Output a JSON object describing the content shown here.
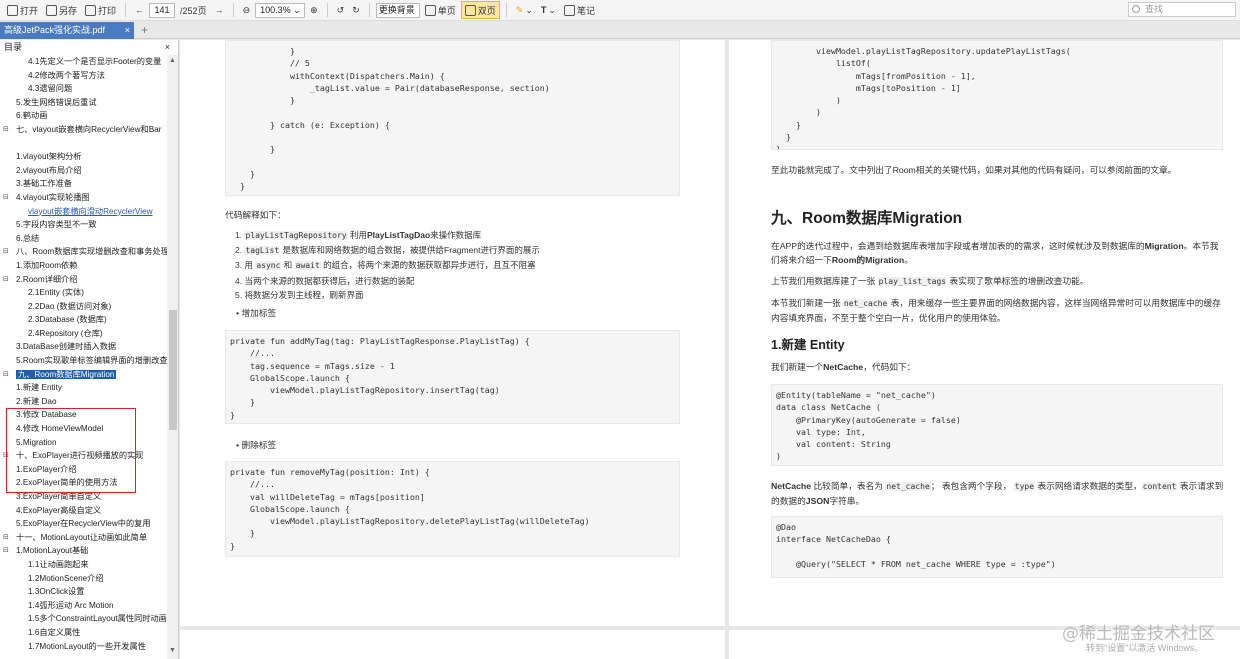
{
  "toolbar": {
    "open": "打开",
    "save_as": "另存",
    "print": "打印",
    "page_current": "141",
    "page_total": "/252页",
    "zoom": "100.3%",
    "background": "更换背景",
    "single_page": "单页",
    "double_page": "双页",
    "text": "T",
    "notes": "笔记",
    "search_placeholder": "查找"
  },
  "tab": {
    "title": "高级JetPack强化实战.pdf",
    "plus": "+"
  },
  "sidebar": {
    "title": "目录",
    "items": [
      {
        "label": "4.1先定义一个是否显示Footer的变量",
        "indent": 28,
        "toggle": ""
      },
      {
        "label": "4.2修改两个著写方法",
        "indent": 28,
        "toggle": ""
      },
      {
        "label": "4.3遗留问题",
        "indent": 28,
        "toggle": ""
      },
      {
        "label": "5.发生网络错误后重试",
        "indent": 16,
        "toggle": ""
      },
      {
        "label": "6.鹤动画",
        "indent": 16,
        "toggle": ""
      },
      {
        "label": "七、vlayout嵌套横向RecyclerView和Bar",
        "indent": 16,
        "toggle": "⊟"
      },
      {
        "label": "",
        "indent": 16,
        "toggle": ""
      },
      {
        "label": "1.vlayout架构分析",
        "indent": 16,
        "toggle": ""
      },
      {
        "label": "2.vlayout布局介绍",
        "indent": 16,
        "toggle": ""
      },
      {
        "label": "3.基础工作准备",
        "indent": 16,
        "toggle": ""
      },
      {
        "label": "4.vlayout实现轮播图",
        "indent": 16,
        "toggle": "⊟"
      },
      {
        "label": "vlayout嵌套横向滑动RecyclerView",
        "indent": 28,
        "toggle": "",
        "link": true
      },
      {
        "label": "5.字段内容类型不一致",
        "indent": 16,
        "toggle": ""
      },
      {
        "label": "6.总结",
        "indent": 16,
        "toggle": ""
      },
      {
        "label": "八、Room数据库实现增删改查和事务处理",
        "indent": 16,
        "toggle": "⊟"
      },
      {
        "label": "1.添加Room依赖",
        "indent": 16,
        "toggle": ""
      },
      {
        "label": "2.Room详细介绍",
        "indent": 16,
        "toggle": "⊟"
      },
      {
        "label": "2.1Entity (实体)",
        "indent": 28,
        "toggle": ""
      },
      {
        "label": "2.2Dao (数据访问对象)",
        "indent": 28,
        "toggle": ""
      },
      {
        "label": "2.3Database (数据库)",
        "indent": 28,
        "toggle": ""
      },
      {
        "label": "2.4Repository (仓库)",
        "indent": 28,
        "toggle": ""
      },
      {
        "label": "3.DataBase创建时插入数据",
        "indent": 16,
        "toggle": ""
      },
      {
        "label": "5.Room实现歌单标签编辑界面的增删改查",
        "indent": 16,
        "toggle": ""
      },
      {
        "label": "九、Room数据库Migration",
        "indent": 16,
        "toggle": "⊟",
        "selected": true
      },
      {
        "label": "1.新建 Entity",
        "indent": 16,
        "toggle": ""
      },
      {
        "label": "2.新建 Dao",
        "indent": 16,
        "toggle": ""
      },
      {
        "label": "3.修改 Database",
        "indent": 16,
        "toggle": ""
      },
      {
        "label": "4.修改 HomeViewModel",
        "indent": 16,
        "toggle": ""
      },
      {
        "label": "5.Migration",
        "indent": 16,
        "toggle": ""
      },
      {
        "label": "十、ExoPlayer进行视频播放的实现",
        "indent": 16,
        "toggle": "⊟"
      },
      {
        "label": "1.ExoPlayer介绍",
        "indent": 16,
        "toggle": ""
      },
      {
        "label": "2.ExoPlayer简单的使用方法",
        "indent": 16,
        "toggle": ""
      },
      {
        "label": "3.ExoPlayer简单自定义",
        "indent": 16,
        "toggle": ""
      },
      {
        "label": "4.ExoPlayer高级自定义",
        "indent": 16,
        "toggle": ""
      },
      {
        "label": "5.ExoPlayer在RecyclerView中的复用",
        "indent": 16,
        "toggle": ""
      },
      {
        "label": "十一、MotionLayout让动画如此简单",
        "indent": 16,
        "toggle": "⊟"
      },
      {
        "label": "1.MotionLayout基础",
        "indent": 16,
        "toggle": "⊟"
      },
      {
        "label": "1.1让动画跑起来",
        "indent": 28,
        "toggle": ""
      },
      {
        "label": "1.2MotionScene介绍",
        "indent": 28,
        "toggle": ""
      },
      {
        "label": "1.3OnClick设置",
        "indent": 28,
        "toggle": ""
      },
      {
        "label": "1.4弧形运动 Arc Motion",
        "indent": 28,
        "toggle": ""
      },
      {
        "label": "1.5多个ConstraintLayout属性同时动画",
        "indent": 28,
        "toggle": ""
      },
      {
        "label": "1.6自定义属性",
        "indent": 28,
        "toggle": ""
      },
      {
        "label": "1.7MotionLayout的一些开发属性",
        "indent": 28,
        "toggle": ""
      }
    ]
  },
  "left_page": {
    "code_top": "            }\n            // 5\n            withContext(Dispatchers.Main) {\n                _tagList.value = Pair(databaseResponse, section)\n            }\n\n        } catch (e: Exception) {\n\n        }\n\n    }\n  }\n}",
    "explain_title": "代码解释如下：",
    "list": [
      {
        "num": "1.",
        "code": "playListTagRepository",
        "mid": " 利用",
        "bold": "PlayListTagDao",
        "rest": "来操作数据库"
      },
      {
        "num": "2.",
        "code": "tagList",
        "mid": " 是数据库和网络数据的组合数据，被提供给Fragment进行界面的展示",
        "bold": "",
        "rest": ""
      },
      {
        "num": "3.",
        "pre": "用 ",
        "code": "async",
        "mid": " 和 ",
        "code2": "await",
        "rest": " 的组合，将两个来源的数据获取都异步进行，且互不阻塞"
      },
      {
        "num": "4.",
        "rest": "当两个来源的数据都获得后，进行数据的装配"
      },
      {
        "num": "5.",
        "rest": "将数据分发到主线程，刷新界面"
      }
    ],
    "bullet1": "增加标签",
    "code_add": "private fun addMyTag(tag: PlayListTagResponse.PlayListTag) {\n    //...\n    tag.sequence = mTags.size - 1\n    GlobalScope.launch {\n        viewModel.playListTagRepository.insertTag(tag)\n    }\n}",
    "bullet2": "删除标签",
    "code_remove": "private fun removeMyTag(position: Int) {\n    //...\n    val willDeleteTag = mTags[position]\n    GlobalScope.launch {\n        viewModel.playListTagRepository.deletePlayListTag(willDeleteTag)\n    }\n}"
  },
  "right_page": {
    "code_top": "        viewModel.playListTagRepository.updatePlayListTags(\n            listOf(\n                mTags[fromPosition - 1],\n                mTags[toPosition - 1]\n            )\n        )\n    }\n  }\n}",
    "done_text": "至此功能就完成了。文中列出了Room相关的关键代码，如果对其他的代码有疑问，可以参阅前面的文章。",
    "h2": "九、Room数据库Migration",
    "p1a": "在APP的迭代过程中，会遇到给数据库表增加字段或者增加表的的需求，这时候就涉及到数据库的",
    "p1b": "Migration",
    "p1c": "。本节我们将来介绍一下",
    "p1d": "Room的Migration",
    "p1e": "。",
    "p2a": "上节我们用数据库建了一张 ",
    "p2code": "play_list_tags",
    "p2b": " 表实现了歌单标签的增删改查功能。",
    "p3a": "本节我们新建一张 ",
    "p3code": "net_cache",
    "p3b": " 表，用来缓存一些主要界面的网络数据内容，这样当网络异常时可以用数据库中的缓存内容填充界面，不至于整个空白一片，优化用户的使用体验。",
    "h3": "1.新建 Entity",
    "p4a": "我们新建一个",
    "p4b": "NetCache",
    "p4c": "，代码如下：",
    "code_entity": "@Entity(tableName = \"net_cache\")\ndata class NetCache (\n    @PrimaryKey(autoGenerate = false)\n    val type: Int,\n    val content: String\n)",
    "p5a": "NetCache",
    "p5b": " 比较简单，表名为 ",
    "p5code": "net_cache",
    "p5c": "； 表包含两个字段， ",
    "p5code2": "type",
    "p5d": " 表示网络请求数据的类型，",
    "p5code3": "content",
    "p5e": " 表示请求到的数据的",
    "p5f": "JSON",
    "p5g": "字符串。",
    "code_dao": "@Dao\ninterface NetCacheDao {\n\n    @Query(\"SELECT * FROM net_cache WHERE type = :type\")"
  },
  "watermark": {
    "main": "@稀土掘金技术社区",
    "sub": "转到\"设置\"以激活 Windows。"
  }
}
